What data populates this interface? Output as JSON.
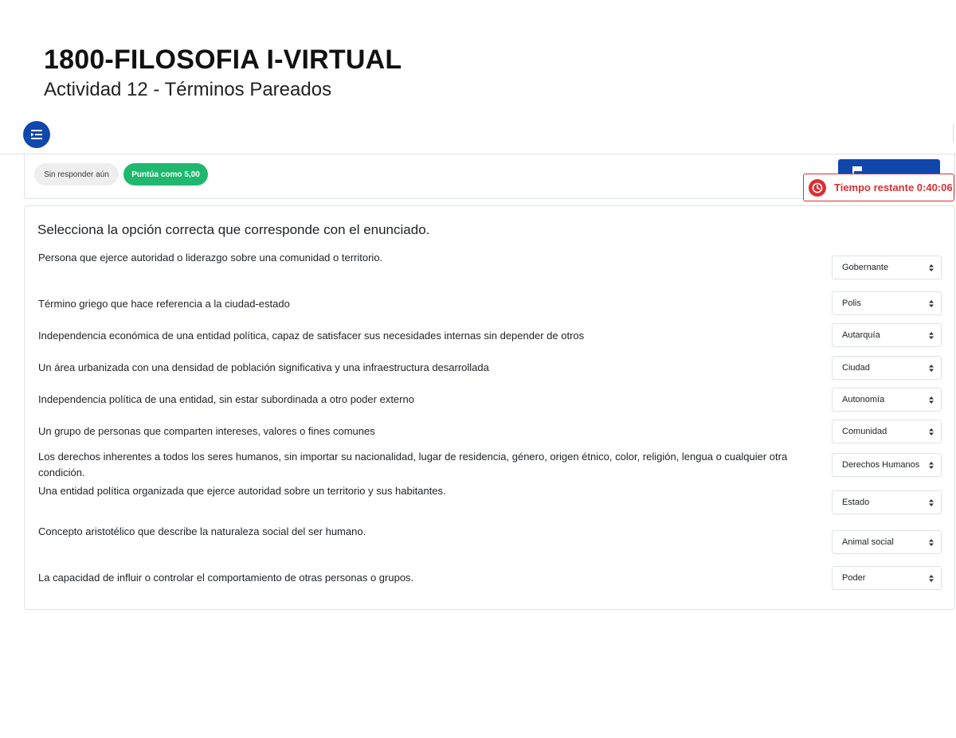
{
  "header": {
    "course_title": "1800-FILOSOFIA I-VIRTUAL",
    "activity_title": "Actividad 12 - Términos Pareados"
  },
  "question_info": {
    "status": "Sin responder aún",
    "points": "Puntúa como 5,00"
  },
  "timer": {
    "label": "Tiempo restante 0:40:06"
  },
  "question": {
    "instruction": "Selecciona la opción correcta que corresponde con el enunciado.",
    "items": [
      {
        "stem": "Persona que ejerce autoridad o liderazgo sobre una comunidad o territorio.",
        "answer": "Gobernante"
      },
      {
        "stem": "Término griego que hace referencia a la ciudad-estado",
        "answer": "Polis"
      },
      {
        "stem": "Independencia económica de una entidad política, capaz de satisfacer sus necesidades internas sin depender de otros",
        "answer": "Autarquía"
      },
      {
        "stem": "Un área urbanizada con una densidad de población significativa y una infraestructura desarrollada",
        "answer": "Ciudad"
      },
      {
        "stem": "Independencia política de una entidad, sin estar subordinada a otro poder externo",
        "answer": "Autonomía"
      },
      {
        "stem": "Un grupo de personas que comparten intereses, valores o fines comunes",
        "answer": "Comunidad"
      },
      {
        "stem": "Los derechos inherentes a todos los seres humanos, sin importar su nacionalidad, lugar de residencia, género, origen étnico, color, religión, lengua o cualquier otra condición.",
        "answer": "Derechos Humanos"
      },
      {
        "stem": "Una entidad política organizada que ejerce autoridad sobre un territorio y sus habitantes.",
        "answer": "Estado"
      },
      {
        "stem": "Concepto aristotélico que describe la naturaleza social del ser humano.",
        "answer": "Animal social"
      },
      {
        "stem": "La capacidad de influir o controlar el comportamiento de otras personas o grupos.",
        "answer": "Poder"
      }
    ]
  },
  "colors": {
    "primary": "#0f47ad",
    "success": "#1fb86e",
    "danger": "#d93035"
  }
}
